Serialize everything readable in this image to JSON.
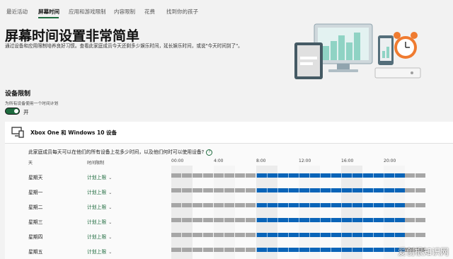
{
  "nav": {
    "items": [
      {
        "label": "最近活动",
        "active": false
      },
      {
        "label": "屏幕时间",
        "active": true
      },
      {
        "label": "应用和游戏限制",
        "active": false
      },
      {
        "label": "内容限制",
        "active": false
      },
      {
        "label": "花费",
        "active": false
      },
      {
        "label": "找到你的孩子",
        "active": false
      }
    ]
  },
  "page": {
    "title": "屏幕时间设置非常简单",
    "description": "通过设备和应用限制培养良好习惯。查看此家庭成员今天还剩多少娱乐时间，延长娱乐时间，或说\"今天时间到了\"。"
  },
  "section": {
    "title": "设备限制",
    "subtitle": "为所有设备使用一个时间计划",
    "toggle_label": "开",
    "toggle_on": true
  },
  "device": {
    "name": "Xbox One 和 Windows 10 设备",
    "question": "此家庭成员每天可以在他们的所有设备上花多少时间，以及他们何时可以使用设备?",
    "help_icon": "?",
    "columns": {
      "day": "天",
      "limit": "时间限制"
    },
    "time_labels": [
      "00:00",
      "4:00",
      "8:00",
      "12:00",
      "16:00",
      "20:00"
    ],
    "allowed_hours": {
      "start": 8,
      "end": 22
    },
    "rows": [
      {
        "day": "星期天",
        "limit": "计划上限"
      },
      {
        "day": "星期一",
        "limit": "计划上限"
      },
      {
        "day": "星期二",
        "limit": "计划上限"
      },
      {
        "day": "星期三",
        "limit": "计划上限"
      },
      {
        "day": "星期四",
        "limit": "计划上限"
      },
      {
        "day": "星期五",
        "limit": "计划上限"
      }
    ]
  },
  "colors": {
    "accent": "#1e6b3e",
    "allowed": "#0a64b8",
    "blocked": "#a6a6a6"
  },
  "watermark": "爱创根知识网"
}
